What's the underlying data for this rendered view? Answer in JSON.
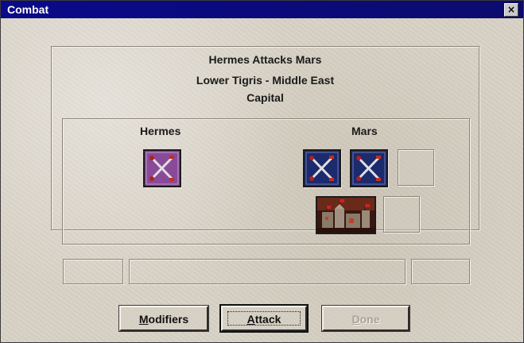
{
  "window": {
    "title": "Combat",
    "close_symbol": "×"
  },
  "header": {
    "line1": "Hermes Attacks Mars",
    "line2": "Lower Tigris - Middle East",
    "line3": "Capital"
  },
  "attacker": {
    "name": "Hermes",
    "units": [
      {
        "icon": "crossed-swords-icon",
        "color": "#7a3a8a"
      }
    ]
  },
  "defender": {
    "name": "Mars",
    "units": [
      {
        "icon": "crossed-swords-icon",
        "color": "#1c2a6e"
      },
      {
        "icon": "crossed-swords-icon",
        "color": "#1c2a6e"
      }
    ],
    "building": {
      "icon": "capital-city-icon"
    }
  },
  "buttons": {
    "modifiers": {
      "hotkey": "M",
      "rest": "odifiers",
      "enabled": true
    },
    "attack": {
      "hotkey": "A",
      "rest": "ttack",
      "enabled": true
    },
    "done": {
      "hotkey": "D",
      "rest": "one",
      "enabled": false
    }
  }
}
